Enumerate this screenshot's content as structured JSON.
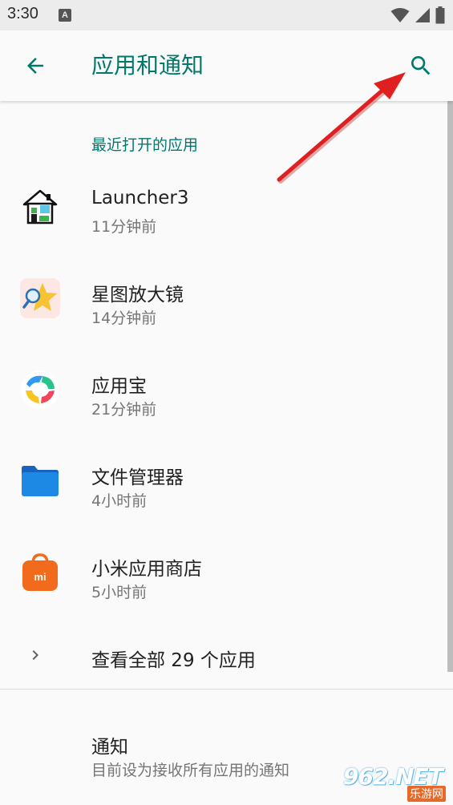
{
  "status_bar": {
    "time": "3:30",
    "notification_icon_letter": "A",
    "icons": [
      "wifi-icon",
      "signal-icon",
      "battery-icon"
    ]
  },
  "app_bar": {
    "title": "应用和通知",
    "back_icon": "arrow-left-icon",
    "search_icon": "search-icon"
  },
  "recent": {
    "header": "最近打开的应用",
    "apps": [
      {
        "name": "Launcher3",
        "time": "11分钟前",
        "icon": "launcher-house-icon"
      },
      {
        "name": "星图放大镜",
        "time": "14分钟前",
        "icon": "star-magnifier-icon"
      },
      {
        "name": "应用宝",
        "time": "21分钟前",
        "icon": "yingyongbao-icon"
      },
      {
        "name": "文件管理器",
        "time": "4小时前",
        "icon": "folder-icon"
      },
      {
        "name": "小米应用商店",
        "time": "5小时前",
        "icon": "mi-store-icon"
      }
    ]
  },
  "see_all": {
    "label": "查看全部 29 个应用",
    "icon": "chevron-right-icon"
  },
  "notifications": {
    "title": "通知",
    "subtitle": "目前设为接收所有应用的通知"
  },
  "watermark": {
    "main": "962.NET",
    "sub": "乐游网"
  },
  "colors": {
    "accent": "#00796b",
    "primary_text": "#212121",
    "secondary_text": "#757575",
    "annotation_arrow": "#e02020"
  }
}
